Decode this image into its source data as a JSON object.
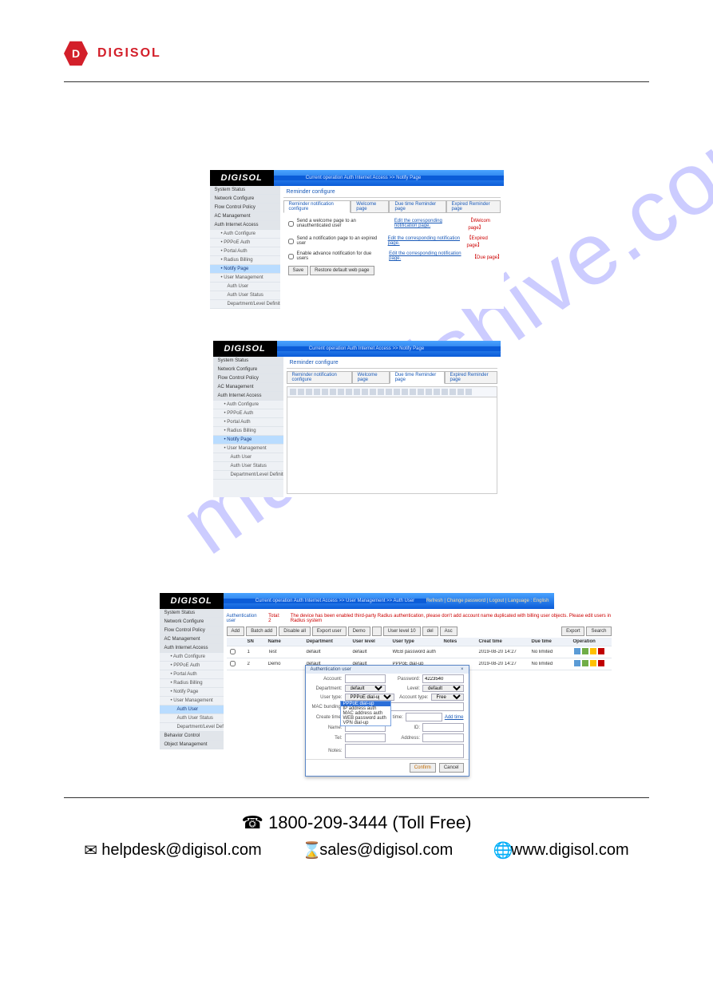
{
  "logo": "DIGISOL",
  "watermark": "manualshive.com",
  "common": {
    "brand": "DIGISOL",
    "sidebar_auth_children": [
      "Auth Configure",
      "PPPoE Auth",
      "Portal Auth",
      "Radius Billing",
      "Notify Page",
      "User Management"
    ],
    "sidebar_user_mgmt_children": [
      "Auth User",
      "Auth User Status",
      "Department/Level Definition"
    ]
  },
  "shot1": {
    "crumb": "Current operation  Auth Internet Access >> Notify Page",
    "title": "Reminder configure",
    "tabs": [
      "Reminder notification configure",
      "Welcome page",
      "Due time Reminder page",
      "Expired Reminder page"
    ],
    "active_tab": 0,
    "sidebar_top": [
      "System Status",
      "Network Configure",
      "Flow Control Policy",
      "AC Management",
      "Auth Internet Access"
    ],
    "options": [
      {
        "label": "Send a welcome page to an unauthenticated user",
        "link": "Edit the corresponding notification page.",
        "bracket": "Welcom page"
      },
      {
        "label": "Send a notification page to an expired user",
        "link": "Edit the corresponding notification page.",
        "bracket": "Expired page"
      },
      {
        "label": "Enable advance notification for due users",
        "link": "Edit the corresponding notification page.",
        "bracket": "Due page"
      }
    ],
    "buttons": [
      "Save",
      "Restore default web page"
    ]
  },
  "shot2": {
    "crumb": "Current operation  Auth Internet Access >> Notify Page",
    "title": "Reminder configure",
    "tabs": [
      "Reminder notification configure",
      "Welcome page",
      "Due time Reminder page",
      "Expired Reminder page"
    ],
    "active_tab": 2,
    "sidebar_top": [
      "System Status",
      "Network Configure",
      "Flow Control Policy",
      "AC Management",
      "Auth Internet Access"
    ]
  },
  "shot3": {
    "crumb": "Current operation  Auth Internet Access >> User Management >> Auth User",
    "topbar_right": "Refresh | Change password | Logout | Language : English",
    "sidebar_top": [
      "System Status",
      "Network Configure",
      "Flow Control Policy",
      "AC Management",
      "Auth Internet Access"
    ],
    "sidebar_bottom": [
      "Behavior Control",
      "Object Management"
    ],
    "title": "Authentication user",
    "tip_label": "Total: 2",
    "warning": "The device has been enabled third-party Radius authentication, please don't add account name duplicated with billing user objects. Please edit users in Radius system",
    "action_bar": [
      "Add",
      "Batch add",
      "Disable all",
      "Export user",
      "Demo",
      "",
      "User level 10",
      "del",
      "Asc"
    ],
    "action_bar_right": [
      "Export",
      "Search"
    ],
    "columns": [
      "",
      "SN",
      "Name",
      "Department",
      "User level",
      "User type",
      "Notes",
      "Creat time",
      "Due time",
      "Operation"
    ],
    "rows": [
      {
        "sn": "1",
        "name": "Test",
        "dept": "default",
        "ulevel": "default",
        "utype": "WEB password auth",
        "notes": "",
        "ctime": "2019-08-20 14:27",
        "due": "No limited"
      },
      {
        "sn": "2",
        "name": "Demo",
        "dept": "default",
        "ulevel": "default",
        "utype": "PPPoE dial-up",
        "notes": "",
        "ctime": "2019-08-20 14:27",
        "due": "No limited"
      }
    ],
    "dialog": {
      "title": "Authentication user",
      "account_label": "Account:",
      "password_label": "Password:",
      "password_value": "4223540",
      "dept_label": "Department:",
      "dept_value": "default",
      "level_label": "Level:",
      "level_value": "default",
      "utype_label": "User type:",
      "utype_value": "PPPoE dial-up",
      "dropdown_options": [
        "PPPoE dial-up",
        "IP address auth",
        "MAC address auth",
        "WEB password auth",
        "VPN dial-up"
      ],
      "acct_label": "Account type:",
      "acct_value": "Free",
      "mac_label": "MAC bunding:",
      "create_label": "Create time:",
      "expire_label": "Expire time:",
      "add_time": "Add time",
      "name_label": "Name:",
      "id_label": "ID:",
      "tel_label": "Tel:",
      "addr_label": "Address:",
      "notes_label": "Notes:",
      "confirm": "Confirm",
      "cancel": "Cancel"
    }
  },
  "footer": {
    "phone": "1800-209-3444 (Toll Free)",
    "helpdesk": "helpdesk@digisol.com",
    "sales": "sales@digisol.com",
    "web": "www.digisol.com"
  }
}
